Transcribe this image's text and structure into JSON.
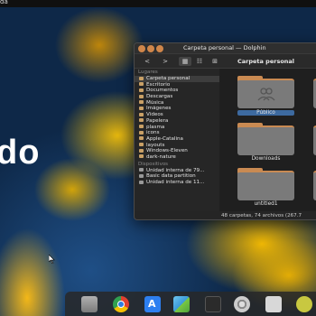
{
  "topbar": {
    "text": "da"
  },
  "wallpaper_text": "do",
  "window": {
    "title": "Carpeta personal — Dolphin",
    "breadcrumb": "Carpeta personal",
    "toolbar": {
      "back": "<",
      "forward": ">",
      "view_icons": "▦",
      "view_compact": "☷",
      "view_details": "⊞"
    },
    "sidebar": {
      "places_header": "Lugares",
      "places": [
        "Carpeta personal",
        "Escritorio",
        "Documentos",
        "Descargas",
        "Música",
        "Imágenes",
        "Vídeos",
        "Papelera",
        "plasma",
        "icons",
        "Apple-Catalina",
        "layouts",
        "Windows-Eleven",
        "dark-nature"
      ],
      "devices_header": "Dispositivos",
      "devices": [
        "Unidad interna de 79...",
        "Basic data partition",
        "Unidad interna de 11..."
      ]
    },
    "folders": [
      "Público",
      "Downloads",
      "untitled1"
    ],
    "status": "48 carpetas, 74 archivos (267.7"
  },
  "dock": {
    "icons": [
      "folder-icon",
      "chrome-icon",
      "app-store-icon",
      "photos-icon",
      "terminal-icon",
      "settings-icon",
      "script-icon",
      "spotify-icon"
    ]
  }
}
